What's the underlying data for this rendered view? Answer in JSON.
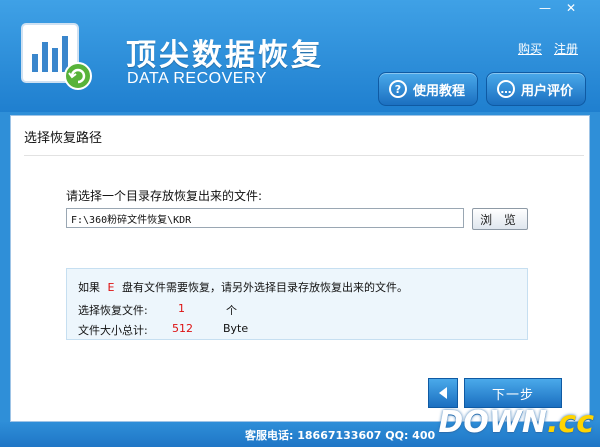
{
  "app": {
    "title_cn": "顶尖数据恢复",
    "title_en": "DATA RECOVERY"
  },
  "window_controls": {
    "minimize": "—",
    "close": "✕"
  },
  "header_links": {
    "buy": "购买",
    "register": "注册"
  },
  "header_buttons": {
    "tutorial": {
      "label": "使用教程",
      "icon": "question-icon"
    },
    "review": {
      "label": "用户评价",
      "icon": "comment-icon"
    }
  },
  "section": {
    "title": "选择恢复路径",
    "prompt": "请选择一个目录存放恢复出来的文件:",
    "path_value": "F:\\360粉碎文件恢复\\KDR",
    "browse_label": "浏 览"
  },
  "info": {
    "line1_prefix": "如果",
    "drive": "E",
    "line1_suffix": "盘有文件需要恢复，请另外选择目录存放恢复出来的文件。",
    "files_label": "选择恢复文件:",
    "files_count": "1",
    "files_unit": "个",
    "size_label": "文件大小总计:",
    "size_value": "512",
    "size_unit": "Byte"
  },
  "nav": {
    "next_label": "下一步"
  },
  "footer": {
    "contact": "客服电话: 18667133607  QQ: 400"
  },
  "watermark": {
    "main": "DOWN",
    "suffix": ".cc"
  },
  "colors": {
    "header": "#2f8fd8",
    "accent_red": "#dd1111",
    "info_bg": "#edf6fc"
  }
}
